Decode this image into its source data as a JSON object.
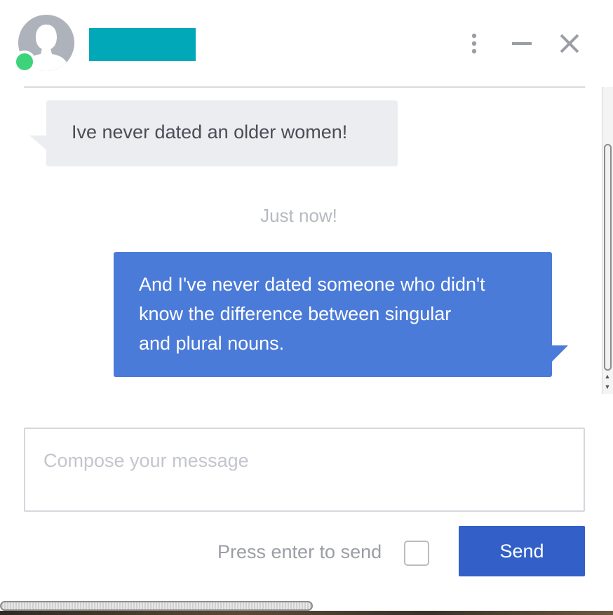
{
  "header": {
    "avatar_icon": "user-silhouette-icon",
    "status": "online",
    "status_color": "#3dd37a",
    "name_bar_color": "#00a8b8",
    "more_icon": "vertical-dots-icon",
    "minimize_icon": "minimize-icon",
    "close_icon": "close-icon"
  },
  "messages": [
    {
      "direction": "incoming",
      "text": "Ive never dated an older women!"
    },
    {
      "direction": "outgoing",
      "lines": [
        "And I've never dated someone who didn't",
        "know the difference between singular",
        "and plural nouns."
      ]
    }
  ],
  "timestamp": "Just now!",
  "composer": {
    "placeholder": "Compose your message",
    "enter_label": "Press enter to send",
    "enter_checked": false,
    "send_label": "Send"
  },
  "colors": {
    "outgoing_bubble": "#4b7bd8",
    "incoming_bubble": "#ebedf0",
    "send_button": "#3260c8"
  }
}
